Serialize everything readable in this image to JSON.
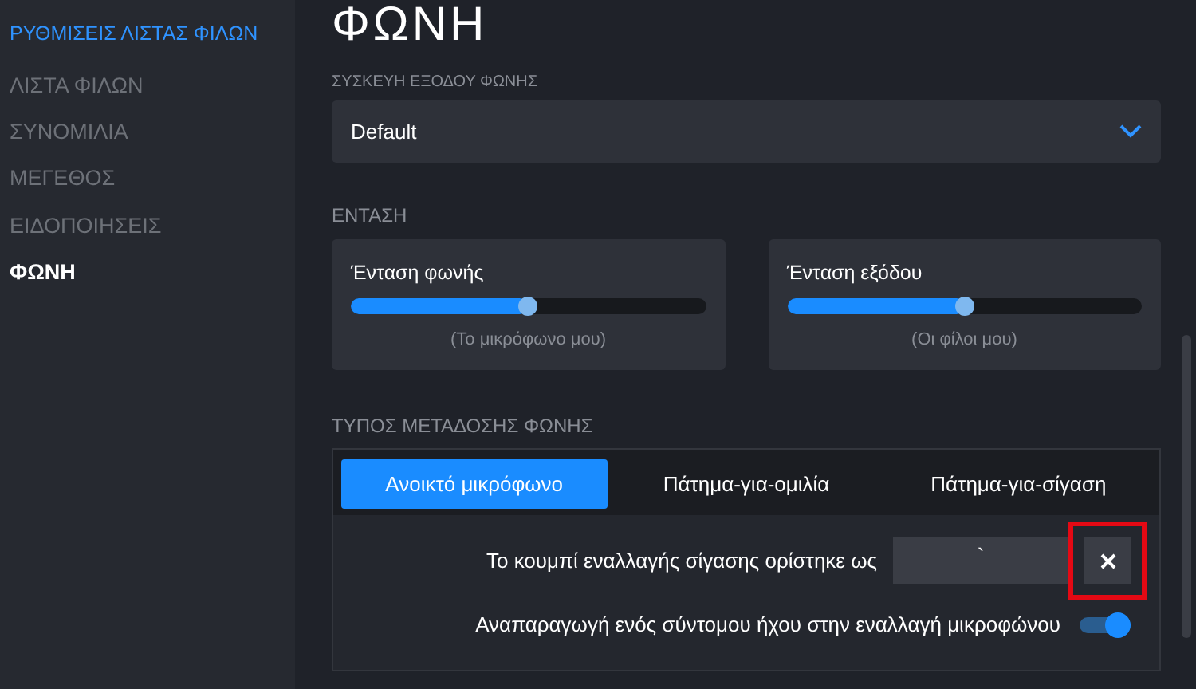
{
  "sidebar": {
    "title": "ΡΥΘΜΙΣΕΙΣ ΛΙΣΤΑΣ ΦΙΛΩΝ",
    "items": [
      {
        "label": "ΛΙΣΤΑ ΦΙΛΩΝ",
        "selected": false
      },
      {
        "label": "ΣΥΝΟΜΙΛΙΑ",
        "selected": false
      },
      {
        "label": "ΜΕΓΕΘΟΣ",
        "selected": false
      },
      {
        "label": "ΕΙΔΟΠΟΙΗΣΕΙΣ",
        "selected": false
      },
      {
        "label": "ΦΩΝΗ",
        "selected": true
      }
    ]
  },
  "page": {
    "title": "ΦΩΝΗ"
  },
  "output_device": {
    "label": "ΣΥΣΚΕΥΗ ΕΞΟΔΟΥ ΦΩΝΗΣ",
    "value": "Default"
  },
  "volume": {
    "label": "ΕΝΤΑΣΗ",
    "sliders": [
      {
        "name": "Ένταση φωνής",
        "level": 0.5,
        "caption": "(Το μικρόφωνο μου)"
      },
      {
        "name": "Ένταση εξόδου",
        "level": 0.5,
        "caption": "(Οι φίλοι μου)"
      }
    ]
  },
  "transmission": {
    "label": "ΤΥΠΟΣ ΜΕΤΑΔΟΣΗΣ ΦΩΝΗΣ",
    "tabs": [
      {
        "label": "Ανοικτό μικρόφωνο",
        "selected": true
      },
      {
        "label": "Πάτημα-για-ομιλία",
        "selected": false
      },
      {
        "label": "Πάτημα-για-σίγαση",
        "selected": false
      }
    ],
    "key_label": "Το κουμπί εναλλαγής σίγασης ορίστηκε ως",
    "key_value": "`",
    "clear_highlighted": true,
    "toggle_label": "Αναπαραγωγή ενός σύντομου ήχου στην εναλλαγή μικροφώνου",
    "toggle_on": true
  }
}
